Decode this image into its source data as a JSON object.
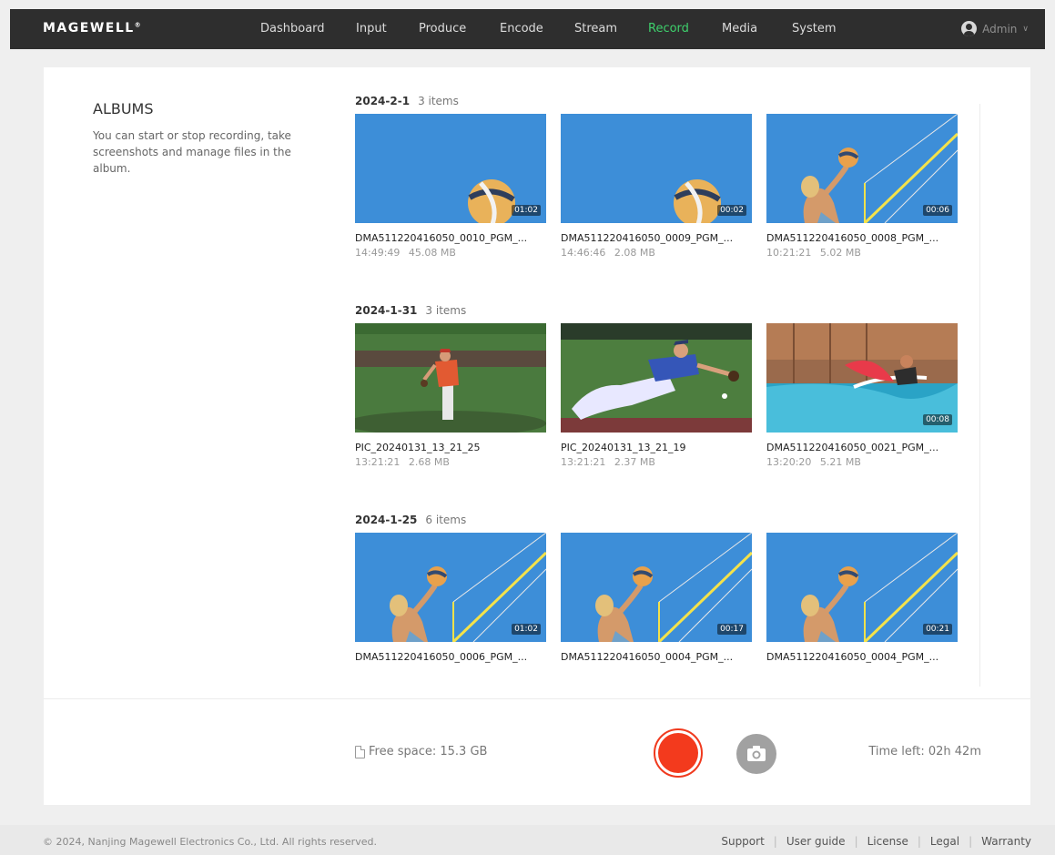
{
  "brand": {
    "logo": "MAGEWELL",
    "registered": "®"
  },
  "nav": {
    "items": [
      {
        "label": "Dashboard"
      },
      {
        "label": "Input"
      },
      {
        "label": "Produce"
      },
      {
        "label": "Encode"
      },
      {
        "label": "Stream"
      },
      {
        "label": "Record",
        "active": true
      },
      {
        "label": "Media"
      },
      {
        "label": "System"
      }
    ],
    "active_color": "#3ed06c",
    "user": {
      "name": "Admin",
      "icon": "avatar-icon",
      "menu_icon": "chevron-down-icon"
    }
  },
  "sidebar": {
    "title": "ALBUMS",
    "description": "You can start or stop recording, take screenshots and manage files in the album."
  },
  "albums": [
    {
      "date": "2024-2-1",
      "count": "3 items",
      "files": [
        {
          "name": "DMA511220416050_0010_PGM_...",
          "time": "14:49:49",
          "size": "45.08 MB",
          "duration": "01:02",
          "thumb": "sky-ball"
        },
        {
          "name": "DMA511220416050_0009_PGM_...",
          "time": "14:46:46",
          "size": "2.08 MB",
          "duration": "00:02",
          "thumb": "sky-ball"
        },
        {
          "name": "DMA511220416050_0008_PGM_...",
          "time": "10:21:21",
          "size": "5.02 MB",
          "duration": "00:06",
          "thumb": "volleyball"
        }
      ]
    },
    {
      "date": "2024-1-31",
      "count": "3 items",
      "files": [
        {
          "name": "PIC_20240131_13_21_25",
          "time": "13:21:21",
          "size": "2.68 MB",
          "thumb": "pitcher"
        },
        {
          "name": "PIC_20240131_13_21_19",
          "time": "13:21:21",
          "size": "2.37 MB",
          "thumb": "diving-player"
        },
        {
          "name": "DMA511220416050_0021_PGM_...",
          "time": "13:20:20",
          "size": "5.21 MB",
          "duration": "00:08",
          "thumb": "surfer"
        }
      ]
    },
    {
      "date": "2024-1-25",
      "count": "6 items",
      "files": [
        {
          "name": "DMA511220416050_0006_PGM_...",
          "duration": "01:02",
          "thumb": "volleyball"
        },
        {
          "name": "DMA511220416050_0004_PGM_...",
          "duration": "00:17",
          "thumb": "volleyball"
        },
        {
          "name": "DMA511220416050_0004_PGM_...",
          "duration": "00:21",
          "thumb": "volleyball"
        }
      ]
    }
  ],
  "controls": {
    "free_space": "Free space: 15.3 GB",
    "time_left": "Time left: 02h 42m",
    "record_color": "#f33a1d",
    "storage_icon": "sd-card-icon",
    "snapshot_icon": "camera-icon"
  },
  "footer": {
    "copyright": "© 2024, Nanjing Magewell Electronics Co., Ltd. All rights reserved.",
    "links": [
      "Support",
      "User guide",
      "License",
      "Legal",
      "Warranty"
    ]
  }
}
